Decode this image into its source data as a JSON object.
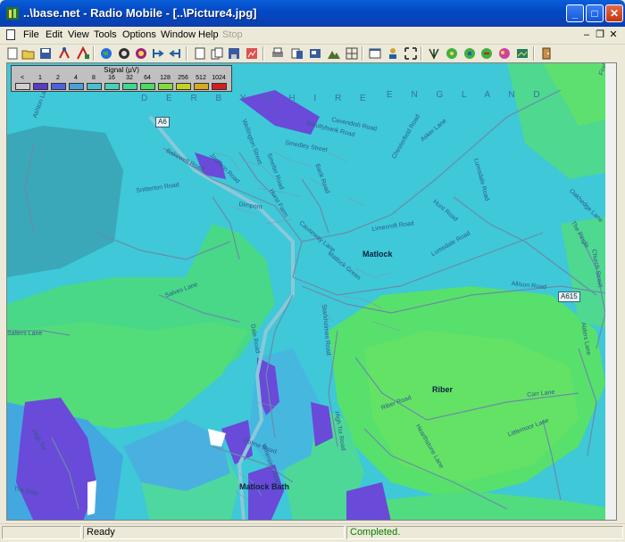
{
  "window": {
    "title": "..\\base.net - Radio Mobile - [..\\Picture4.jpg]"
  },
  "menu": [
    "File",
    "Edit",
    "View",
    "Tools",
    "Options",
    "Window",
    "Help",
    "Stop"
  ],
  "legend": {
    "title": "Signal (µV)",
    "values": [
      "<",
      "1",
      "2",
      "4",
      "8",
      "16",
      "32",
      "64",
      "128",
      "256",
      "512",
      "1024"
    ],
    "colors": [
      "#d0d0d0",
      "#5a3ac8",
      "#4a63e0",
      "#4aa0d8",
      "#48c0d0",
      "#48d0b8",
      "#3ed890",
      "#4adc60",
      "#80dc40",
      "#c8d020",
      "#d8a820",
      "#d02020"
    ]
  },
  "map": {
    "region_labels": [
      "D E R B Y S H I R E",
      "E N G L A N D"
    ],
    "towns": [
      "Matlock",
      "Riber",
      "Matlock Bath"
    ],
    "road_signs": [
      "A6",
      "A615"
    ],
    "roads": [
      "Bakewell Road",
      "Dimpont",
      "Smedley Street",
      "Cavendish Road",
      "Chesterfield Road",
      "Asker Lane",
      "Hunt Road",
      "Lumsdale Road",
      "Oakhedge Lane",
      "The Pingle",
      "Church Street",
      "Limecroft Road",
      "Lumsdale Road",
      "Causeway Lane",
      "Matlock Green",
      "Allison Road",
      "Salves Lane",
      "Dale Road",
      "Starkholmes Road",
      "Carr Lane",
      "Riber Road",
      "Hearthstone Lane",
      "Littlemoor Lane",
      "Holme Road",
      "High Tor Road",
      "Wellington Street",
      "Bank Road",
      "Smelter Road",
      "Snitterton Road",
      "Smuttybank Road",
      "Hurst Farm",
      "Jackson Road",
      "Ashton Lane",
      "Salters Lane",
      "Willersley Road",
      "Foxholes",
      "The Dale",
      "High Tor",
      "Alders Lane",
      "Cavendish Road"
    ]
  },
  "status": {
    "ready": "Ready",
    "completed": "Completed."
  }
}
